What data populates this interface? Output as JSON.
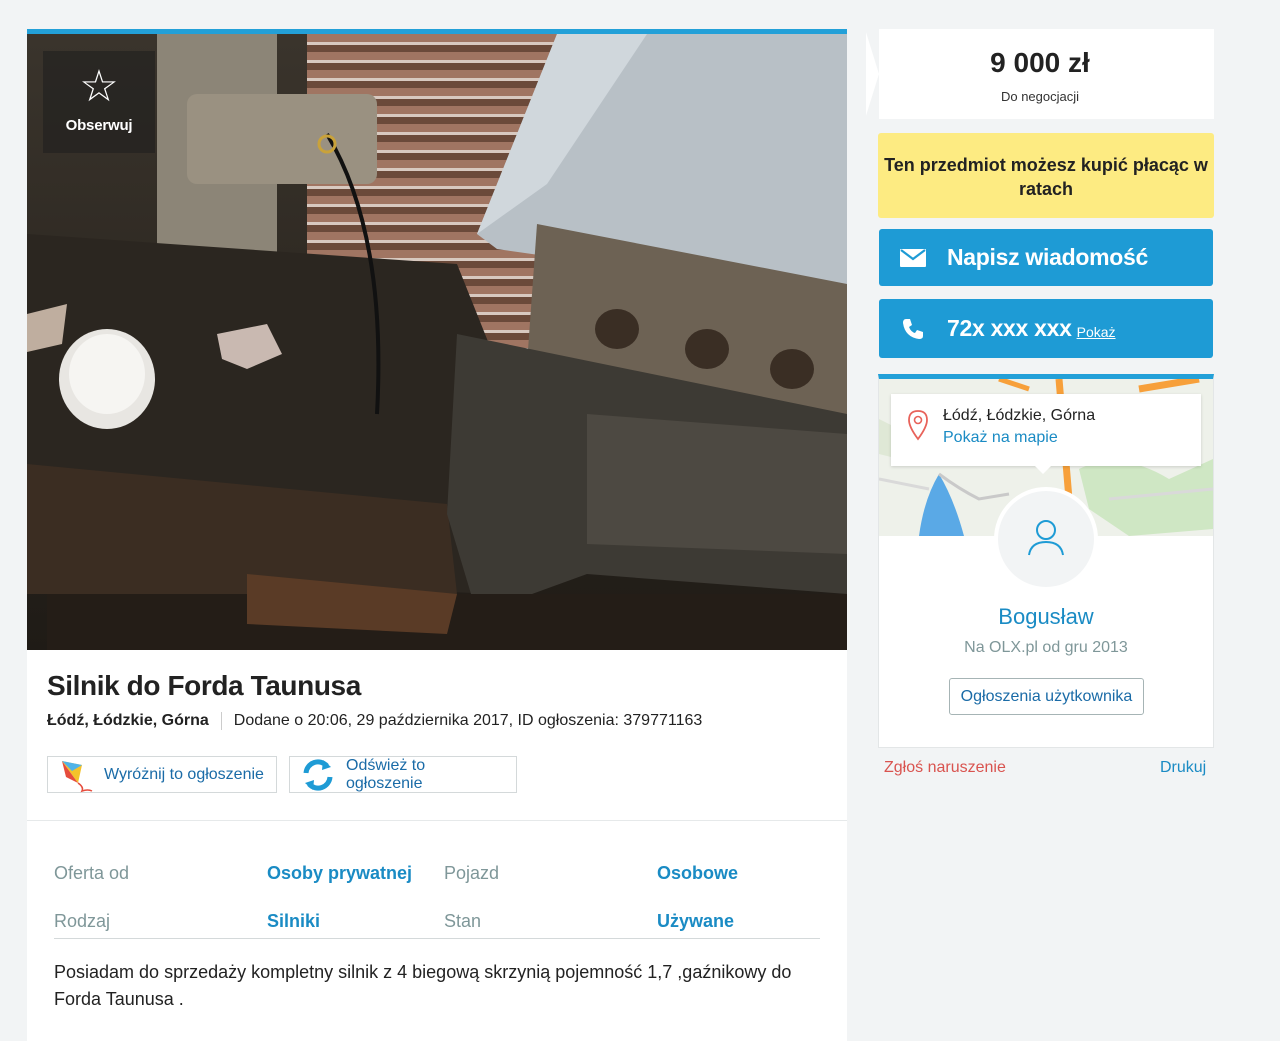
{
  "ad": {
    "observe_label": "Obserwuj",
    "title": "Silnik do Forda Taunusa",
    "location": "Łódź, Łódzkie, Górna",
    "added": "Dodane o 20:06, 29 października 2017, ID ogłoszenia: 379771163",
    "actions": {
      "highlight_label": "Wyróżnij to ogłoszenie",
      "refresh_label": "Odśwież to ogłoszenie"
    },
    "params": [
      {
        "key1": "Oferta od",
        "val1": "Osoby prywatnej",
        "key2": "Pojazd",
        "val2": "Osobowe"
      },
      {
        "key1": "Rodzaj",
        "val1": "Silniki",
        "key2": "Stan",
        "val2": "Używane"
      }
    ],
    "description": "Posiadam do sprzedaży kompletny silnik z 4 biegową skrzynią pojemność 1,7 ,gaźnikowy do Forda Taunusa ."
  },
  "sidebar": {
    "price": "9 000 zł",
    "price_note": "Do negocjacji",
    "installment_text": "Ten przedmiot możesz kupić płacąc w ratach",
    "message_button": "Napisz wiadomość",
    "phone_masked": "72x xxx xxx",
    "phone_show": "Pokaż",
    "map": {
      "location": "Łódź, Łódzkie, Górna",
      "show_on_map": "Pokaż na mapie"
    },
    "user": {
      "name": "Bogusław",
      "since": "Na OLX.pl od gru 2013",
      "ads_button": "Ogłoszenia użytkownika"
    },
    "report_link": "Zgłoś naruszenie",
    "print_link": "Drukuj"
  },
  "colors": {
    "accent_blue": "#1e9bd5",
    "link_blue": "#1a8bc4",
    "installment_yellow": "#fdeb82",
    "report_red": "#d9534f"
  },
  "icons": [
    "star-icon",
    "kite-icon",
    "refresh-icon",
    "envelope-icon",
    "phone-icon",
    "map-pin-icon",
    "user-icon"
  ]
}
